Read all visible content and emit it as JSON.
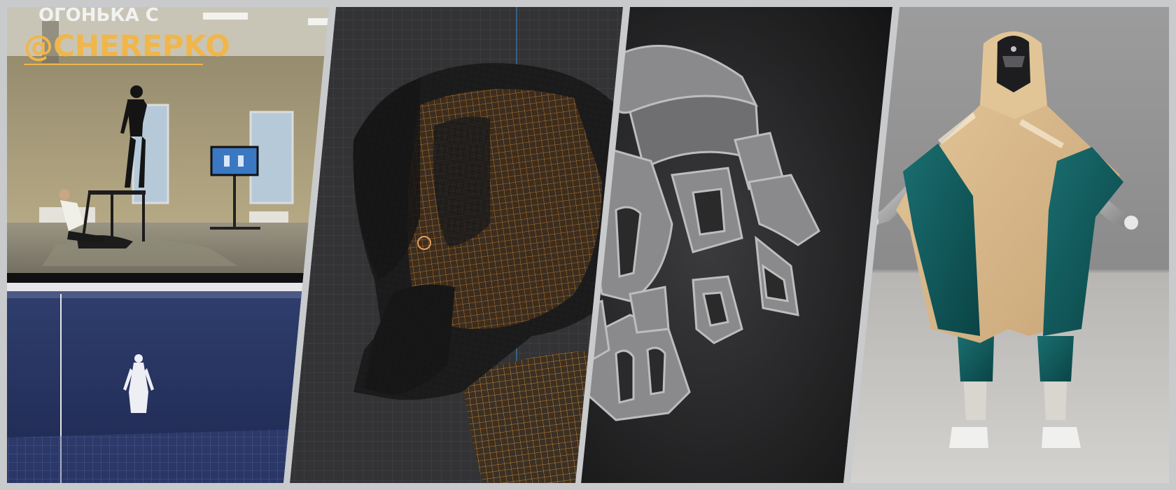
{
  "story": {
    "line1": "ОГОНЬКА С",
    "handle": "@CHEREPKO"
  },
  "colors": {
    "frame": "#c9cacc",
    "handle": "#f0b64a",
    "wire_orange": "#e89a3c",
    "viewport_blue": "#2f3e6e",
    "cloth_sand": "#d8b98c",
    "cloth_teal": "#0f5a5c"
  },
  "panels": [
    {
      "name": "motion-capture-studio",
      "icon": "camera-photo"
    },
    {
      "name": "helmet-wireframe",
      "icon": "mesh-wireframe"
    },
    {
      "name": "helmet-parts-render",
      "icon": "mesh-solid"
    },
    {
      "name": "character-render",
      "icon": "figure-render"
    }
  ]
}
